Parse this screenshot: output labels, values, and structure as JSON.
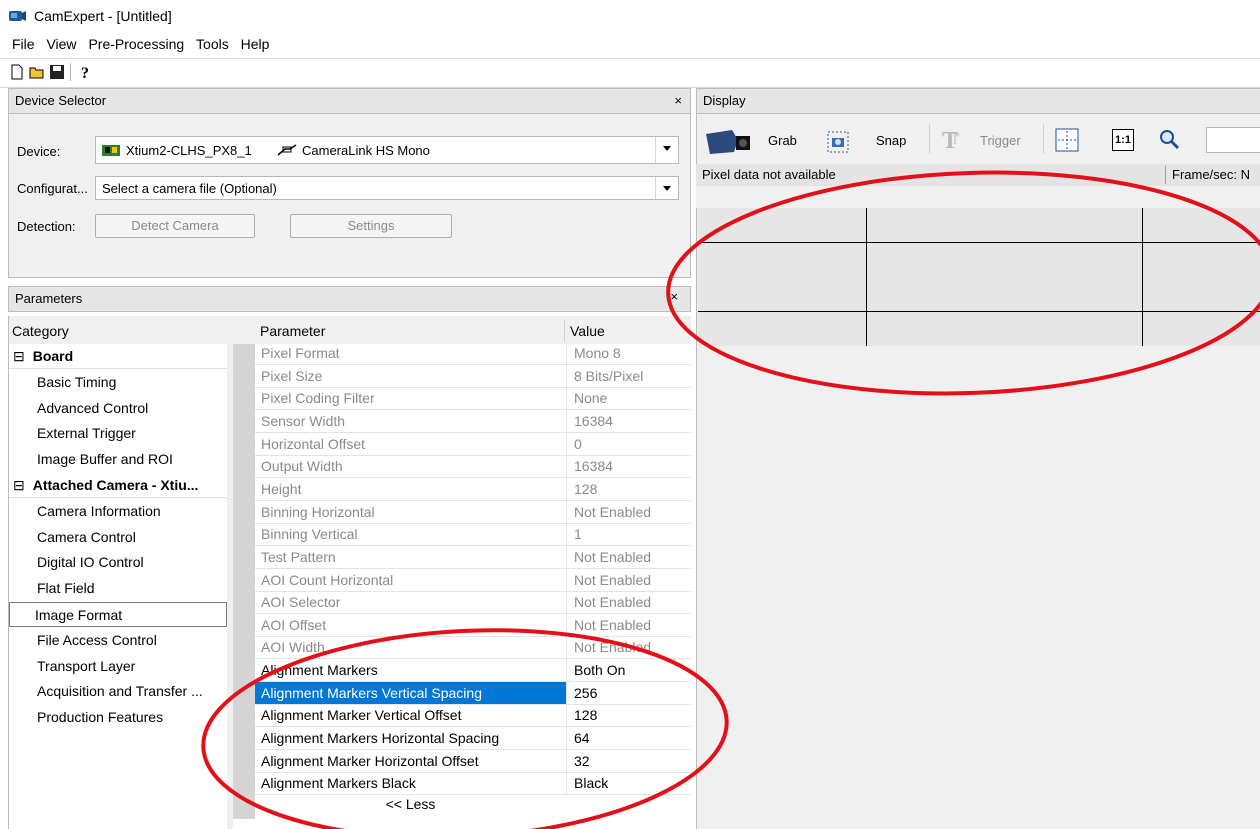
{
  "window": {
    "title": "CamExpert - [Untitled]"
  },
  "menu": [
    "File",
    "View",
    "Pre-Processing",
    "Tools",
    "Help"
  ],
  "toolbar_icons": [
    "new-file-icon",
    "open-folder-icon",
    "save-icon",
    "help-icon"
  ],
  "device_selector": {
    "header": "Device Selector",
    "close": "×",
    "device_label": "Device:",
    "device_value": "Xtium2-CLHS_PX8_1",
    "device_type": "CameraLink HS Mono",
    "config_label": "Configurat...",
    "config_value": "Select a camera file (Optional)",
    "detection_label": "Detection:",
    "detect_button": "Detect Camera",
    "settings_button": "Settings"
  },
  "parameters": {
    "header": "Parameters",
    "close": "×",
    "category_header": "Category",
    "parameter_header": "Parameter",
    "value_header": "Value",
    "categories": [
      {
        "label": "Board",
        "type": "group",
        "box": "⊟"
      },
      {
        "label": "Basic Timing",
        "type": "item"
      },
      {
        "label": "Advanced Control",
        "type": "item"
      },
      {
        "label": "External Trigger",
        "type": "item"
      },
      {
        "label": "Image Buffer and ROI",
        "type": "item"
      },
      {
        "label": "Attached Camera - Xtiu...",
        "type": "group",
        "box": "⊟"
      },
      {
        "label": "Camera Information",
        "type": "item"
      },
      {
        "label": "Camera Control",
        "type": "item"
      },
      {
        "label": "Digital IO Control",
        "type": "item"
      },
      {
        "label": "Flat Field",
        "type": "item"
      },
      {
        "label": "Image Format",
        "type": "selected"
      },
      {
        "label": "File Access Control",
        "type": "item"
      },
      {
        "label": "Transport Layer",
        "type": "item"
      },
      {
        "label": "Acquisition and Transfer ...",
        "type": "item"
      },
      {
        "label": "Production Features",
        "type": "item"
      }
    ],
    "rows": [
      {
        "name": "Pixel Format",
        "value": "Mono 8",
        "state": "disabled"
      },
      {
        "name": "Pixel Size",
        "value": "8 Bits/Pixel",
        "state": "disabled"
      },
      {
        "name": "Pixel Coding Filter",
        "value": "None",
        "state": "disabled"
      },
      {
        "name": "Sensor Width",
        "value": "16384",
        "state": "disabled"
      },
      {
        "name": "Horizontal Offset",
        "value": "0",
        "state": "disabled"
      },
      {
        "name": "Output Width",
        "value": "16384",
        "state": "disabled"
      },
      {
        "name": "Height",
        "value": "128",
        "state": "disabled"
      },
      {
        "name": "Binning Horizontal",
        "value": "Not Enabled",
        "state": "disabled"
      },
      {
        "name": "Binning Vertical",
        "value": "1",
        "state": "disabled"
      },
      {
        "name": "Test Pattern",
        "value": "Not Enabled",
        "state": "disabled"
      },
      {
        "name": "AOI Count Horizontal",
        "value": "Not Enabled",
        "state": "disabled"
      },
      {
        "name": "AOI Selector",
        "value": "Not Enabled",
        "state": "disabled"
      },
      {
        "name": "AOI Offset",
        "value": "Not Enabled",
        "state": "disabled"
      },
      {
        "name": "AOI Width",
        "value": "Not Enabled",
        "state": "disabled"
      },
      {
        "name": "Alignment Markers",
        "value": "Both On",
        "state": "enabled"
      },
      {
        "name": "Alignment Markers Vertical Spacing",
        "value": "256",
        "state": "selected"
      },
      {
        "name": "Alignment Marker Vertical Offset",
        "value": "128",
        "state": "enabled"
      },
      {
        "name": "Alignment Markers Horizontal Spacing",
        "value": "64",
        "state": "enabled"
      },
      {
        "name": "Alignment Marker Horizontal Offset",
        "value": "32",
        "state": "enabled"
      },
      {
        "name": "Alignment Markers Black",
        "value": "Black",
        "state": "enabled"
      }
    ],
    "less_button": "<< Less"
  },
  "display": {
    "header": "Display",
    "grab": "Grab",
    "snap": "Snap",
    "trigger": "Trigger",
    "one_to_one": "1:1",
    "pixel_status": "Pixel data not available",
    "frame_status": "Frame/sec: N"
  },
  "colors": {
    "selection": "#0078d7",
    "annotation": "#e3101a"
  }
}
